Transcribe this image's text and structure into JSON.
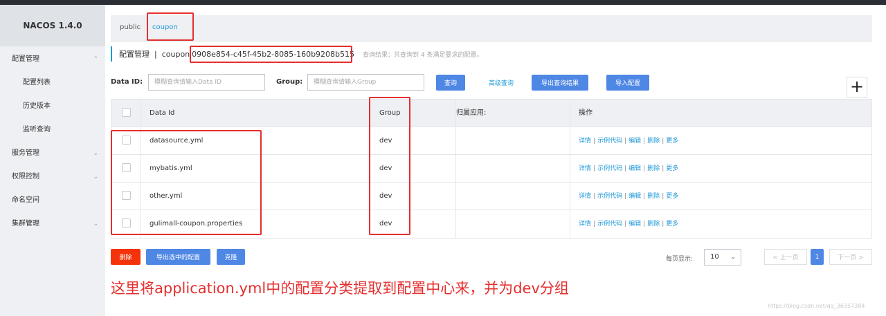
{
  "app": {
    "title": "NACOS 1.4.0"
  },
  "sidebar": {
    "items": [
      {
        "label": "配置管理",
        "expandable": true,
        "expanded": true
      },
      {
        "label": "配置列表",
        "sub": true
      },
      {
        "label": "历史版本",
        "sub": true
      },
      {
        "label": "监听查询",
        "sub": true
      },
      {
        "label": "服务管理",
        "expandable": true
      },
      {
        "label": "权限控制",
        "expandable": true
      },
      {
        "label": "命名空间"
      },
      {
        "label": "集群管理",
        "expandable": true
      }
    ]
  },
  "namespace_tabs": [
    "public",
    "coupon"
  ],
  "active_tab": "coupon",
  "breadcrumb": {
    "title": "配置管理",
    "separator": "|",
    "namespace": "coupon",
    "namespace_id": "0908e854-c45f-45b2-8085-160b9208b515",
    "result_text": "查询结果：共查询到 4 条满足要求的配置。"
  },
  "filters": {
    "data_id_label": "Data ID:",
    "data_id_placeholder": "模糊查询请输入Data ID",
    "group_label": "Group:",
    "group_placeholder": "模糊查询请输入Group",
    "search_button": "查询",
    "advanced_link": "高级查询",
    "export_results_button": "导出查询结果",
    "import_button": "导入配置",
    "add_button": "+"
  },
  "table": {
    "columns": [
      "Data Id",
      "Group",
      "归属应用:",
      "操作"
    ],
    "rows": [
      {
        "data_id": "datasource.yml",
        "group": "dev",
        "app": ""
      },
      {
        "data_id": "mybatis.yml",
        "group": "dev",
        "app": ""
      },
      {
        "data_id": "other.yml",
        "group": "dev",
        "app": ""
      },
      {
        "data_id": "gulimall-coupon.properties",
        "group": "dev",
        "app": ""
      }
    ],
    "actions": [
      "详情",
      "示例代码",
      "编辑",
      "删除",
      "更多"
    ]
  },
  "footer": {
    "delete_button": "删除",
    "export_selected_button": "导出选中的配置",
    "clone_button": "克隆",
    "page_size_label": "每页显示:",
    "page_size": "10",
    "prev_button": "< 上一页",
    "current_page": "1",
    "next_button": "下一页 >"
  },
  "annotation": "这里将application.yml中的配置分类提取到配置中心来，并为dev分组",
  "watermark": "https://blog.csdn.net/qq_36357384",
  "colors": {
    "accent": "#1e98d8",
    "primary_button": "#4f87e5",
    "danger_button": "#f5330b",
    "highlight_box": "#e52e2e"
  }
}
